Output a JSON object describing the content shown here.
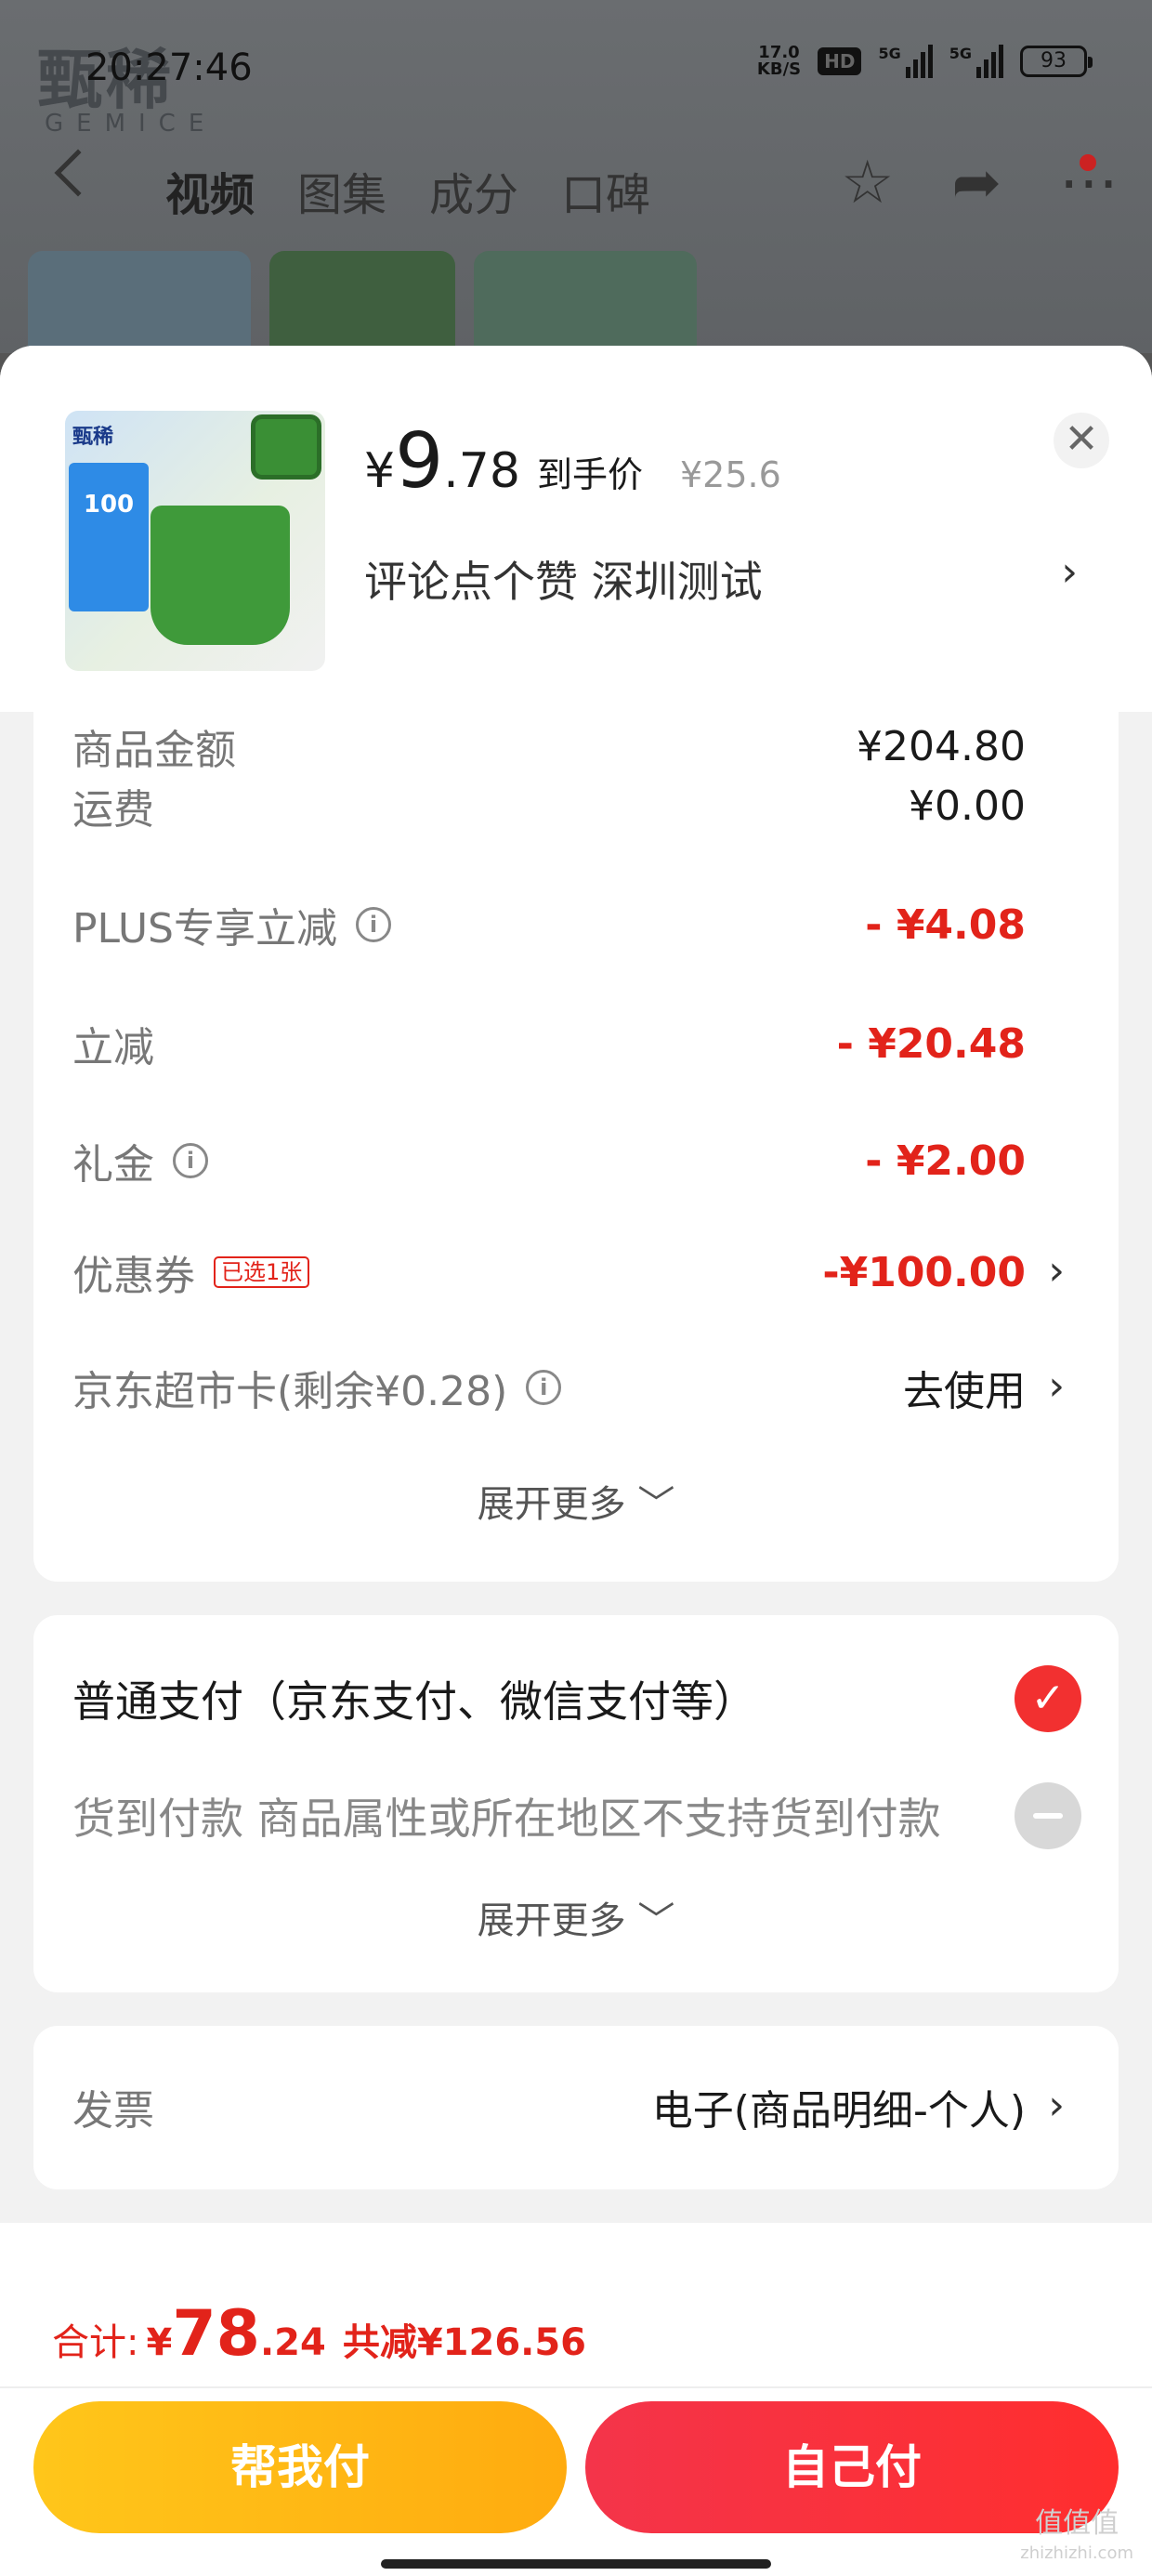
{
  "status_bar": {
    "time": "20:27:46",
    "net_speed_value": "17.0",
    "net_speed_unit": "KB/S",
    "hd": "HD",
    "sig1": "5G",
    "sig2": "5G",
    "battery": "93"
  },
  "background_page": {
    "brand_logo": "甄稀",
    "brand_sub": "GEMICE",
    "tabs": [
      "视频",
      "图集",
      "成分",
      "口碑"
    ],
    "active_tab": "视频"
  },
  "product_header": {
    "image_brand": "甄稀",
    "image_coupon": "100",
    "price_yen": "¥",
    "price_int": "9",
    "price_dec": ".78",
    "price_label": "到手价",
    "original_price": "¥25.6",
    "promo_text": "评论点个赞  深圳测试",
    "close_icon": "✕"
  },
  "price_details": {
    "partial_top_label": "商品金额",
    "partial_top_value": "¥204.80",
    "rows": [
      {
        "label": "运费",
        "value": "¥0.00",
        "info": false
      },
      {
        "label": "PLUS专享立减",
        "value": "- ¥4.08",
        "info": true
      },
      {
        "label": "立减",
        "value": "- ¥20.48",
        "info": false
      },
      {
        "label": "礼金",
        "value": "- ¥2.00",
        "info": true
      }
    ],
    "coupon": {
      "label": "优惠券",
      "tag": "已选1张",
      "value": "-¥100.00"
    },
    "supermarket_card": {
      "label": "京东超市卡(剩余¥0.28)",
      "value": "去使用"
    },
    "expand_more": "展开更多"
  },
  "payment": {
    "normal": "普通支付（京东支付、微信支付等）",
    "cod": "货到付款 商品属性或所在地区不支持货到付款",
    "expand_more": "展开更多"
  },
  "invoice": {
    "label": "发票",
    "value": "电子(商品明细-个人)"
  },
  "footer": {
    "total_label": "合计:",
    "total_yen": "¥",
    "total_int": "78",
    "total_dec": ".24",
    "saved": "共减¥126.56",
    "help_pay_button": "帮我付",
    "self_pay_button": "自己付"
  },
  "watermark": {
    "line1": "值值值",
    "line2": "zhizhizhi.com"
  },
  "colors": {
    "accent_red": "#e2231a",
    "pay_red": "#f23030",
    "help_yellow": "#ffb812",
    "sheet_bg": "#f2f2f2"
  }
}
